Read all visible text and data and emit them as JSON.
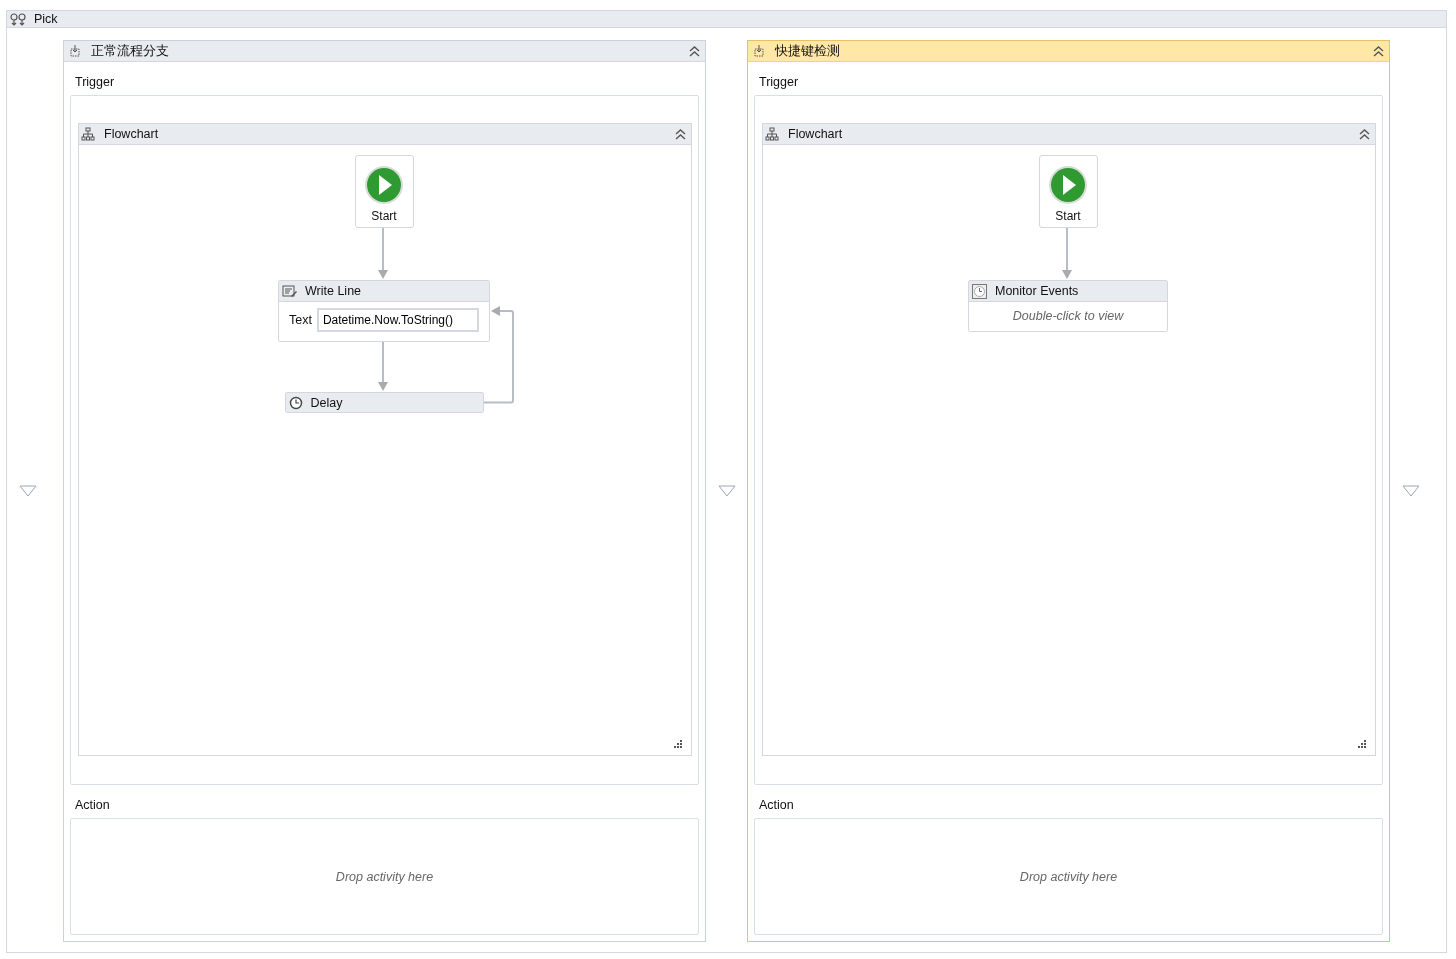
{
  "pick": {
    "title": "Pick"
  },
  "branches": [
    {
      "title": "正常流程分支",
      "selected": false,
      "trigger_label": "Trigger",
      "flowchart": {
        "title": "Flowchart",
        "nodes": [
          {
            "kind": "start",
            "label": "Start"
          },
          {
            "kind": "expression",
            "title": "Write Line",
            "field_label": "Text",
            "value": "Datetime.Now.ToString()"
          },
          {
            "kind": "simple",
            "title": "Delay",
            "loops_back": true
          }
        ]
      },
      "action_label": "Action",
      "action_placeholder": "Drop activity here"
    },
    {
      "title": "快捷键检测",
      "selected": true,
      "trigger_label": "Trigger",
      "flowchart": {
        "title": "Flowchart",
        "nodes": [
          {
            "kind": "start",
            "label": "Start"
          },
          {
            "kind": "collapsed",
            "title": "Monitor Events",
            "hint": "Double-click to view"
          }
        ]
      },
      "action_label": "Action",
      "action_placeholder": "Drop activity here"
    }
  ]
}
